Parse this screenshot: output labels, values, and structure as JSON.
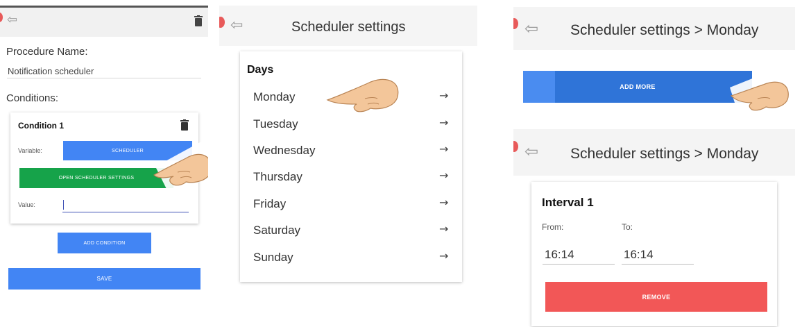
{
  "screen1": {
    "procedure_label": "Procedure Name:",
    "procedure_value": "Notification scheduler",
    "conditions_label": "Conditions:",
    "condition": {
      "title": "Condition 1",
      "variable_label": "Variable:",
      "variable_button": "SCHEDULER",
      "open_settings_button": "OPEN SCHEDULER SETTINGS",
      "value_label": "Value:",
      "value": ""
    },
    "add_condition_button": "ADD CONDITION",
    "save_button": "SAVE"
  },
  "screen2": {
    "title": "Scheduler settings",
    "days_heading": "Days",
    "days": [
      "Monday",
      "Tuesday",
      "Wednesday",
      "Thursday",
      "Friday",
      "Saturday",
      "Sunday"
    ],
    "arrow_glyph": "→"
  },
  "screen3": {
    "title": "Scheduler settings > Monday",
    "add_more_button": "ADD MORE",
    "interval": {
      "title": "Interval 1",
      "from_label": "From:",
      "to_label": "To:",
      "from_value": "16:14",
      "to_value": "16:14"
    },
    "remove_button": "REMOVE"
  },
  "glyphs": {
    "back": "⇦"
  },
  "colors": {
    "primary_blue": "#4285f4",
    "green": "#16a34a",
    "red": "#f25757",
    "underline_indigo": "#3f51b5"
  },
  "icons": [
    "back-arrow-icon",
    "trash-icon",
    "right-arrow-icon",
    "pointing-hand-icon"
  ]
}
